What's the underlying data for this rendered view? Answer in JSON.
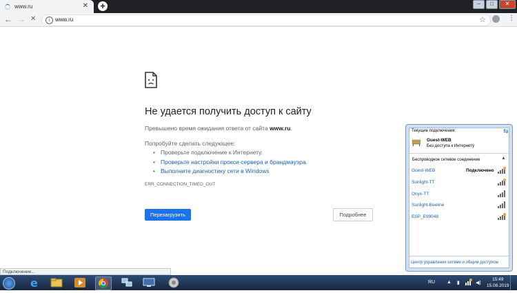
{
  "browser": {
    "tab_title": "www.ru",
    "tab_close": "✕",
    "new_tab": "+",
    "url": "www.ru",
    "window_buttons": [
      "–",
      "□",
      "✕"
    ]
  },
  "error_page": {
    "title": "Не удается получить доступ к сайту",
    "description_prefix": "Превышено время ожидания ответа от сайта ",
    "description_host": "www.ru",
    "description_suffix": ".",
    "try_label": "Попробуйте сделать следующее:",
    "suggestions": [
      "Проверьте подключение к Интернету.",
      "Проверьте настройки прокси-сервера и брандмауэра.",
      "Выполните диагностику сети в Windows"
    ],
    "error_code": "ERR_CONNECTION_TIMED_OUT",
    "reload_label": "Перезагрузить",
    "details_label": "Подробнее"
  },
  "status_bar": "Подключение...",
  "network_flyout": {
    "header": "Текущие подключения:",
    "current_name": "Guest-WEB",
    "current_status": "Без доступа к Интернету",
    "section_title": "Беспроводное сетевое соединение",
    "networks": [
      {
        "name": "Guest-WEB",
        "status": "Подключено",
        "secured": false
      },
      {
        "name": "Sunlight-TT",
        "status": "",
        "secured": false
      },
      {
        "name": "Onyx-TT",
        "status": "",
        "secured": false
      },
      {
        "name": "Sunlight-Beeline",
        "status": "",
        "secured": false
      },
      {
        "name": "ESP_E99048",
        "status": "",
        "secured": false
      }
    ],
    "footer_link": "Центр управления сетями и общим доступом"
  },
  "taskbar": {
    "language": "RU",
    "time": "15:49",
    "date": "15.08.2019"
  },
  "colors": {
    "accent": "#1a73e8",
    "link": "#1a5fbf"
  }
}
